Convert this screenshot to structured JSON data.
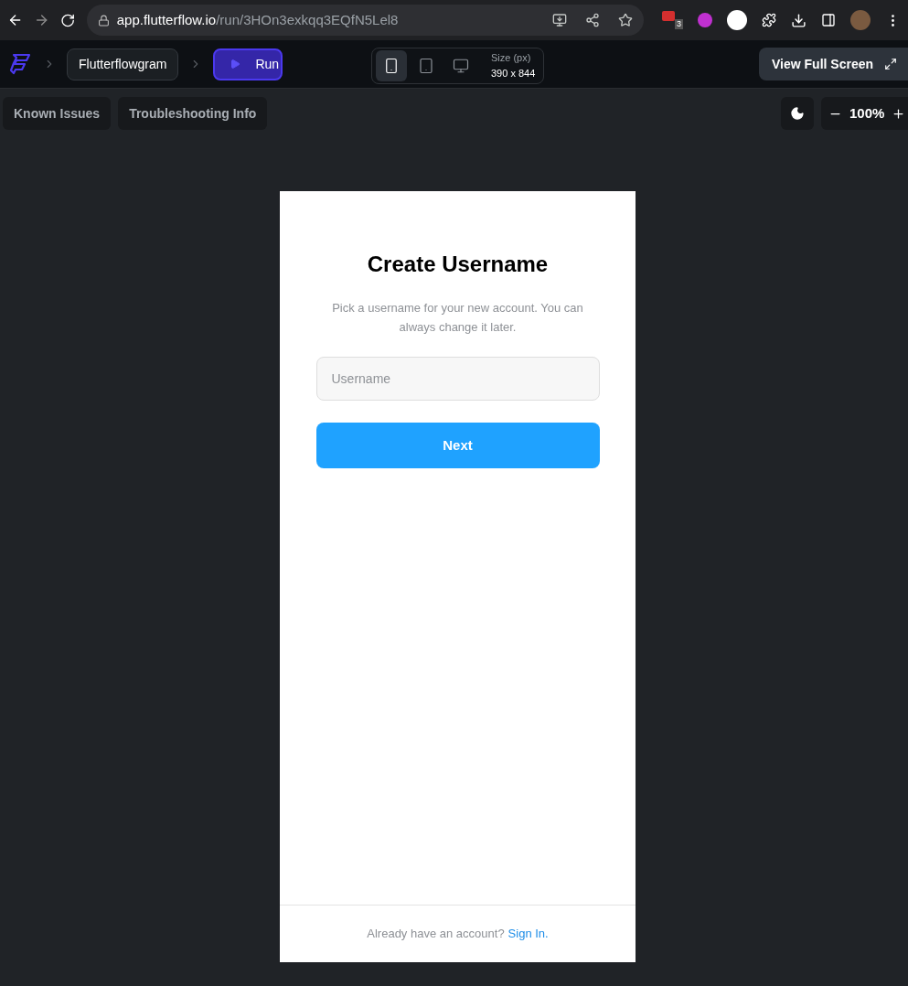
{
  "browser": {
    "url_host": "app.flutterflow.io",
    "url_path": "/run/3HOn3exkqq3EQfN5Lel8",
    "extension_badge": "3"
  },
  "toolbar": {
    "project": "Flutterflowgram",
    "run": "Run",
    "devices": [
      {
        "kind": "phone",
        "selected": true
      },
      {
        "kind": "tablet",
        "selected": false
      },
      {
        "kind": "desktop",
        "selected": false
      }
    ],
    "size_label": "Size (px)",
    "size_value": "390 x 844",
    "full_screen": "View Full Screen"
  },
  "subbar": {
    "buttons": [
      "Known Issues",
      "Troubleshooting Info"
    ],
    "zoom": "100%"
  },
  "app": {
    "title": "Create Username",
    "subtitle": "Pick a username for your new account. You can always change it later.",
    "username_placeholder": "Username",
    "next": "Next",
    "footer_text": "Already have an account?",
    "footer_link": "Sign In."
  }
}
